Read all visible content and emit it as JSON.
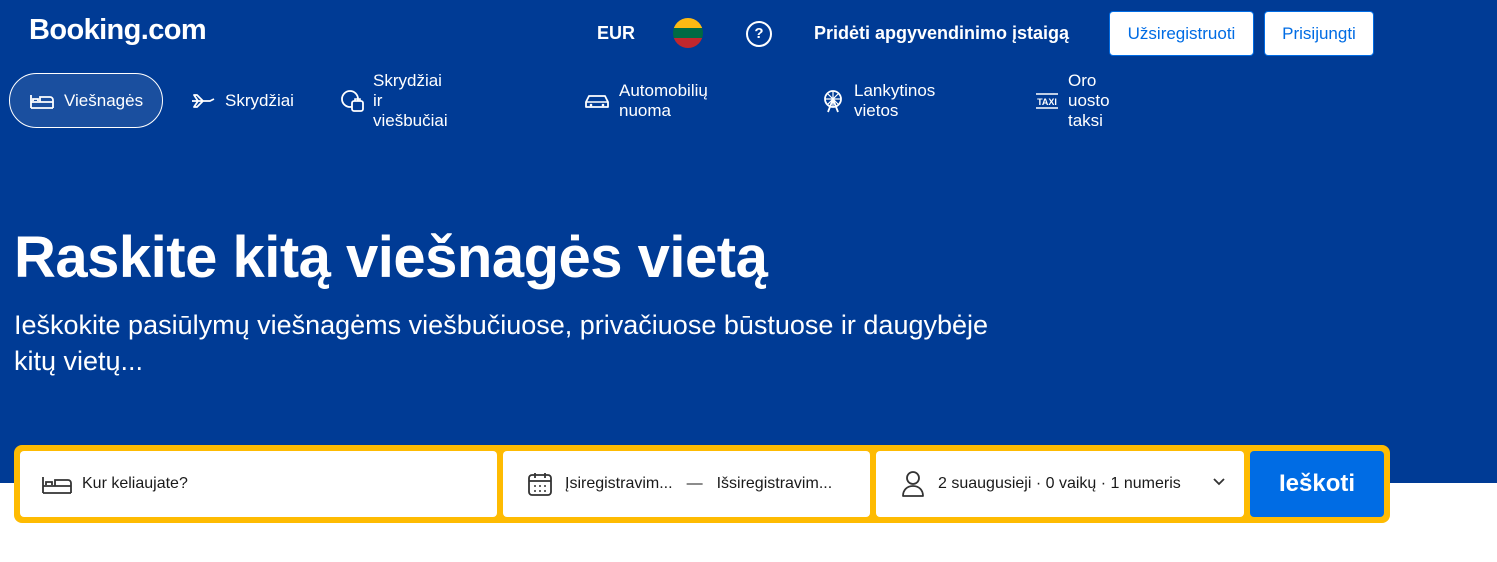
{
  "header": {
    "logo": "Booking.com",
    "currency": "EUR",
    "flag_colors": [
      "#fdb913",
      "#006a44",
      "#c1272d"
    ],
    "help_icon": "question-circle-icon",
    "add_property": "Pridėti apgyvendinimo įstaigą",
    "register_label": "Užsiregistruoti",
    "login_label": "Prisijungti"
  },
  "nav": {
    "items": [
      {
        "label": "Viešnagės",
        "icon": "bed-icon",
        "active": true
      },
      {
        "label": "Skrydžiai",
        "icon": "airplane-icon"
      },
      {
        "label": "Skrydžiai ir viešbučiai",
        "icon": "flight-hotel-icon"
      },
      {
        "label": "Automobilių nuoma",
        "icon": "car-icon"
      },
      {
        "label": "Lankytinos vietos",
        "icon": "ferris-wheel-icon"
      },
      {
        "label": "Oro uosto taksi",
        "icon": "taxi-icon"
      }
    ]
  },
  "hero": {
    "title": "Raskite kitą viešnagės vietą",
    "subtitle": "Ieškokite pasiūlymų viešnagėms viešbučiuose, privačiuose būstuose ir daugybėje kitų vietų..."
  },
  "search": {
    "destination_placeholder": "Kur keliaujate?",
    "checkin": "Įsiregistravim...",
    "separator": "—",
    "checkout": "Išsiregistravim...",
    "guests": "2 suaugusieji · 0 vaikų · 1 numeris",
    "search_label": "Ieškoti"
  },
  "colors": {
    "brand_blue": "#003b95",
    "accent_blue": "#006ce4",
    "search_border": "#febb02"
  }
}
